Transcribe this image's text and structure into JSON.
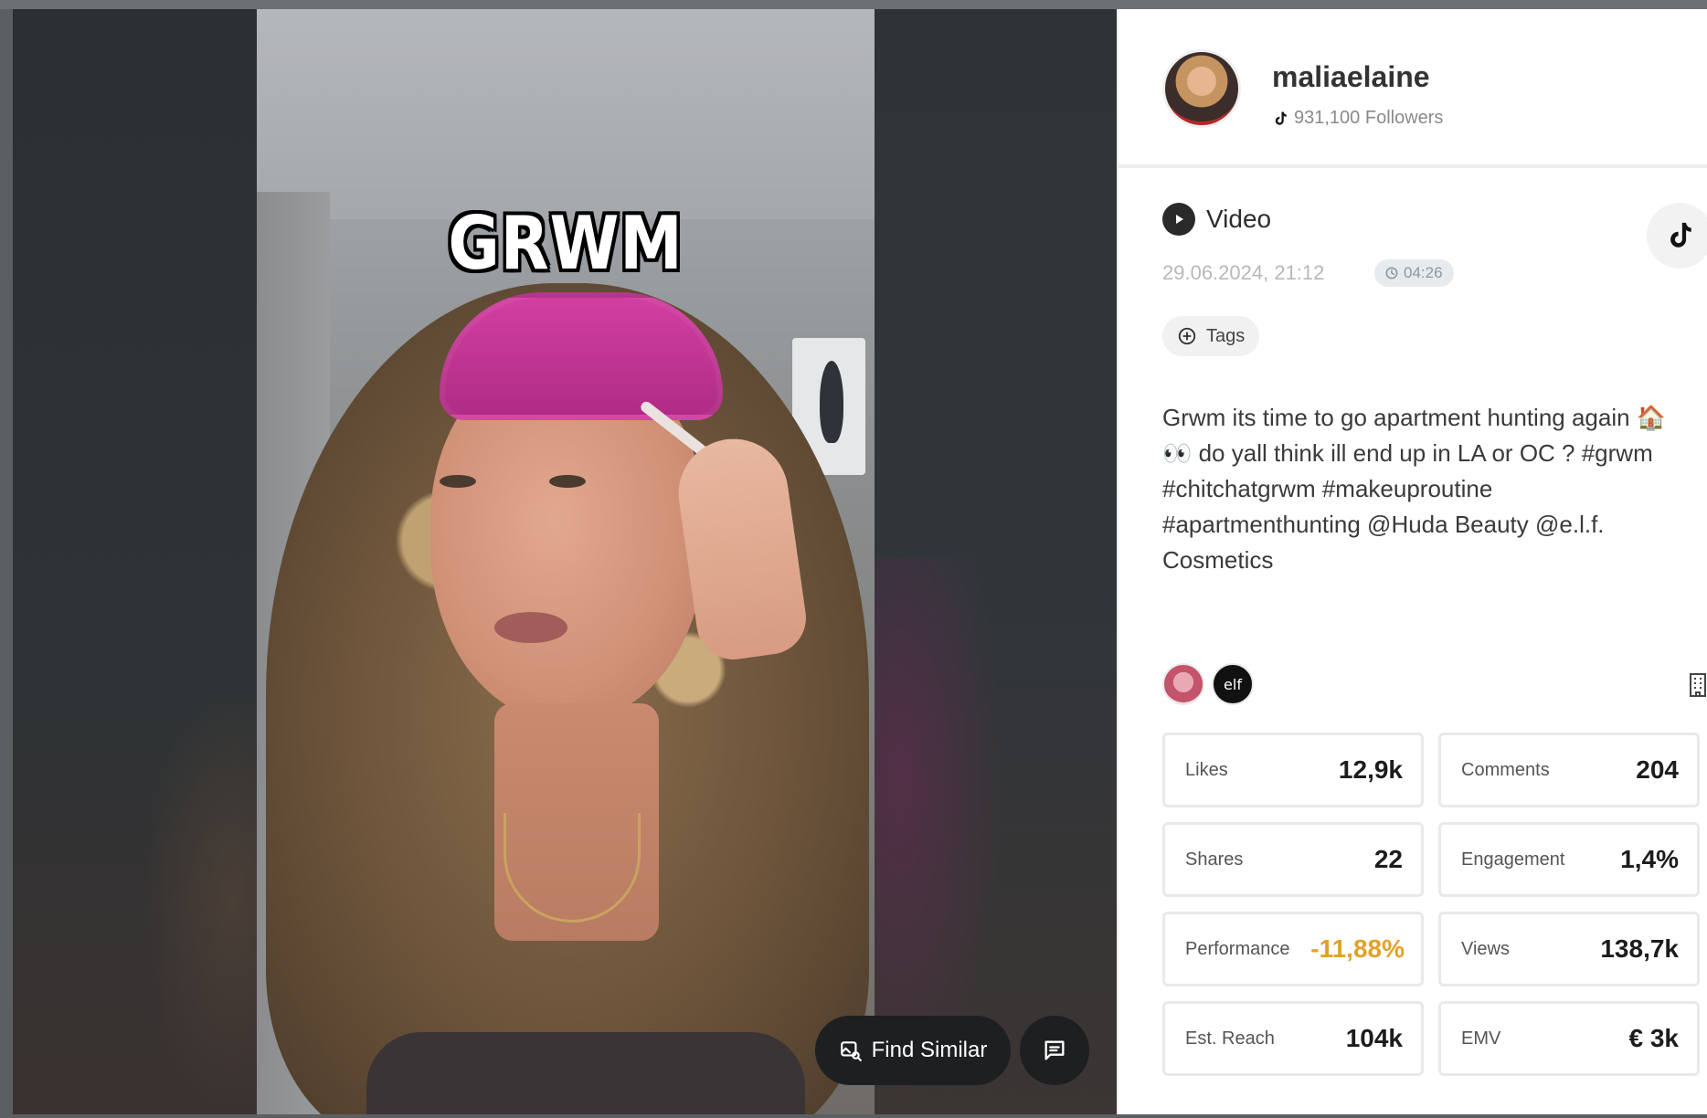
{
  "profile": {
    "username": "maliaelaine",
    "followers": "931,100 Followers",
    "platform_icon": "tiktok-icon"
  },
  "post": {
    "type_label": "Video",
    "date": "29.06.2024, 21:12",
    "duration": "04:26",
    "tags_label": "Tags",
    "caption": "Grwm its time to go apartment hunting again 🏠 👀 do yall think ill end up in LA or OC ? #grwm #chitchatgrwm #makeuproutine #apartmenthunting @Huda Beauty @e.l.f. Cosmetics",
    "mentions": [
      {
        "name": "Huda Beauty",
        "icon": "huda-beauty-avatar"
      },
      {
        "name": "elf",
        "label": "elf"
      }
    ]
  },
  "video": {
    "overlay_text": "GRWM",
    "find_similar_label": "Find Similar"
  },
  "metrics": [
    {
      "label": "Likes",
      "value": "12,9k"
    },
    {
      "label": "Comments",
      "value": "204"
    },
    {
      "label": "Shares",
      "value": "22"
    },
    {
      "label": "Engagement",
      "value": "1,4%"
    },
    {
      "label": "Performance",
      "value": "-11,88%",
      "color": "#e0a22a"
    },
    {
      "label": "Views",
      "value": "138,7k"
    },
    {
      "label": "Est. Reach",
      "value": "104k"
    },
    {
      "label": "EMV",
      "value": "€ 3k"
    }
  ],
  "colors": {
    "performance_negative": "#e0a22a",
    "duration_badge_bg": "#e7ebee"
  }
}
